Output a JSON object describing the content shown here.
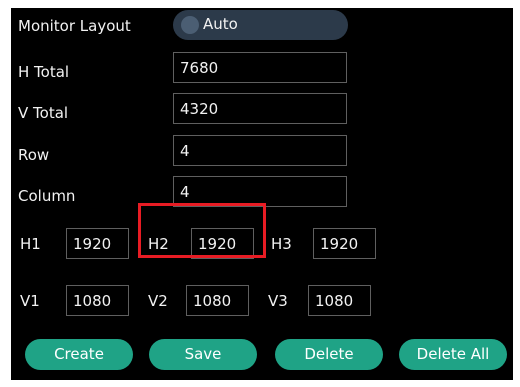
{
  "monitor_layout": {
    "label": "Monitor Layout",
    "mode": "Auto"
  },
  "h_total": {
    "label": "H Total",
    "value": "7680"
  },
  "v_total": {
    "label": "V Total",
    "value": "4320"
  },
  "row": {
    "label": "Row",
    "value": "4"
  },
  "column": {
    "label": "Column",
    "value": "4"
  },
  "widths": [
    {
      "label": "H1",
      "value": "1920"
    },
    {
      "label": "H2",
      "value": "1920"
    },
    {
      "label": "H3",
      "value": "1920"
    }
  ],
  "heights": [
    {
      "label": "V1",
      "value": "1080"
    },
    {
      "label": "V2",
      "value": "1080"
    },
    {
      "label": "V3",
      "value": "1080"
    }
  ],
  "buttons": {
    "create": "Create",
    "save": "Save",
    "delete": "Delete",
    "delete_all": "Delete All"
  },
  "colors": {
    "panel_bg": "#000000",
    "button_accent": "#1fa386",
    "highlight": "#e81c24",
    "toggle_bg": "#2c3a4a"
  }
}
